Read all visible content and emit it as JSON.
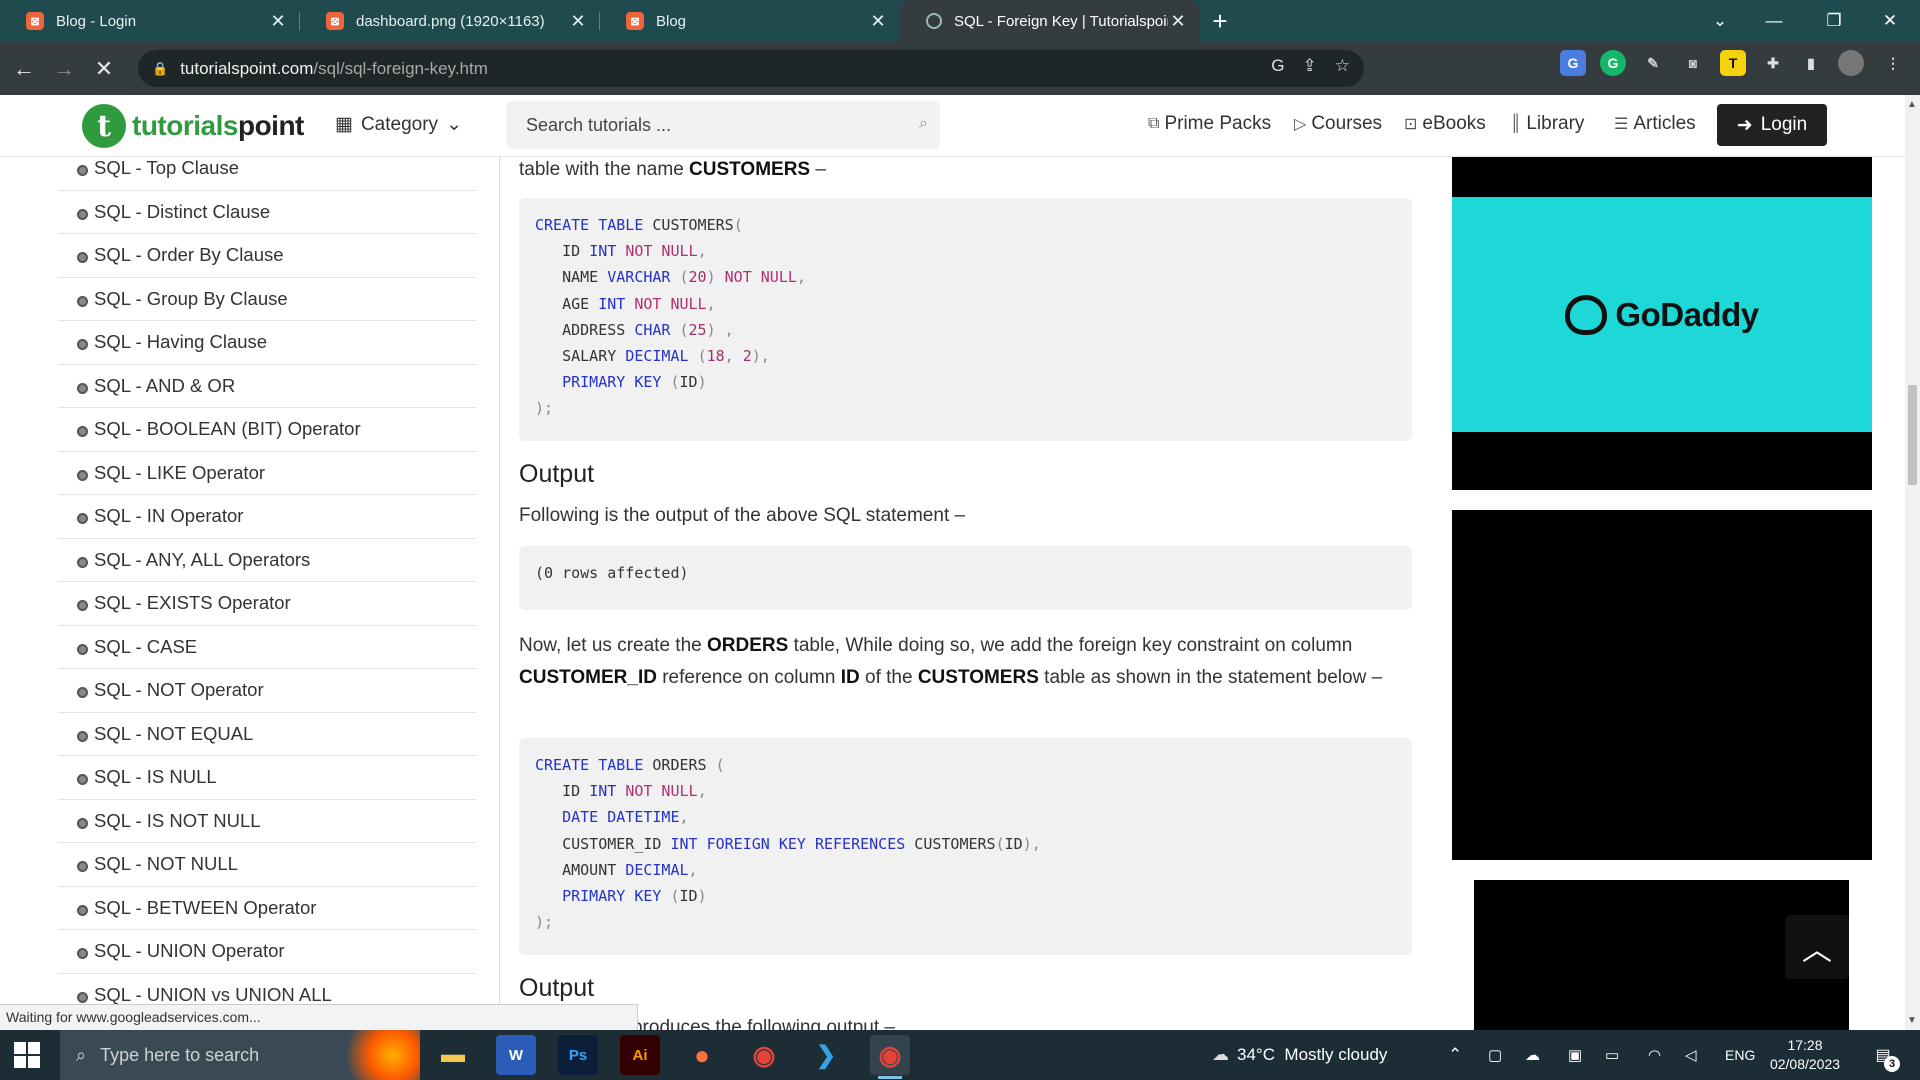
{
  "browser": {
    "tabs": [
      {
        "title": "Blog - Login",
        "favicon": "xampp-icon"
      },
      {
        "title": "dashboard.png (1920×1163)",
        "favicon": "xampp-icon"
      },
      {
        "title": "Blog",
        "favicon": "xampp-icon"
      },
      {
        "title": "SQL - Foreign Key | Tutorialspoin",
        "favicon": "loading-icon",
        "active": true
      }
    ],
    "url_host": "tutorialspoint.com",
    "url_path": "/sql/sql-foreign-key.htm",
    "status_text": "Waiting for www.googleadservices.com..."
  },
  "site_header": {
    "logo_part1": "tutorials",
    "logo_part2": "point",
    "category_label": "Category",
    "search_placeholder": "Search tutorials ...",
    "nav": [
      "Prime Packs",
      "Courses",
      "eBooks",
      "Library",
      "Articles"
    ],
    "login_label": "Login"
  },
  "sidebar": {
    "items": [
      "SQL - Top Clause",
      "SQL - Distinct Clause",
      "SQL - Order By Clause",
      "SQL - Group By Clause",
      "SQL - Having Clause",
      "SQL - AND & OR",
      "SQL - BOOLEAN (BIT) Operator",
      "SQL - LIKE Operator",
      "SQL - IN Operator",
      "SQL - ANY, ALL Operators",
      "SQL - EXISTS Operator",
      "SQL - CASE",
      "SQL - NOT Operator",
      "SQL - NOT EQUAL",
      "SQL - IS NULL",
      "SQL - IS NOT NULL",
      "SQL - NOT NULL",
      "SQL - BETWEEN Operator",
      "SQL - UNION Operator",
      "SQL - UNION vs UNION ALL"
    ]
  },
  "content": {
    "intro_prefix": "table with the name ",
    "intro_bold": "CUSTOMERS",
    "intro_suffix": " –",
    "output_heading_1": "Output",
    "output_text": "Following is the output of the above SQL statement –",
    "output_result": "(0 rows affected)",
    "orders_p1": "Now, let us create the ",
    "orders_b1": "ORDERS",
    "orders_p2": " table, While doing so, we add the foreign key constraint on column ",
    "orders_b2": "CUSTOMER_ID",
    "orders_p3": " reference on column ",
    "orders_b3": "ID",
    "orders_p4": " of the ",
    "orders_b4": "CUSTOMERS",
    "orders_p5": " table as shown in the statement below –",
    "output_heading_2": "Output",
    "output_text_2": "… statement produces the following output –"
  },
  "ads": {
    "brand": "GoDaddy"
  },
  "taskbar": {
    "search_placeholder": "Type here to search",
    "weather": "34°C  Mostly cloudy",
    "lang": "ENG",
    "time": "17:28",
    "date": "02/08/2023",
    "notifications": "3"
  }
}
